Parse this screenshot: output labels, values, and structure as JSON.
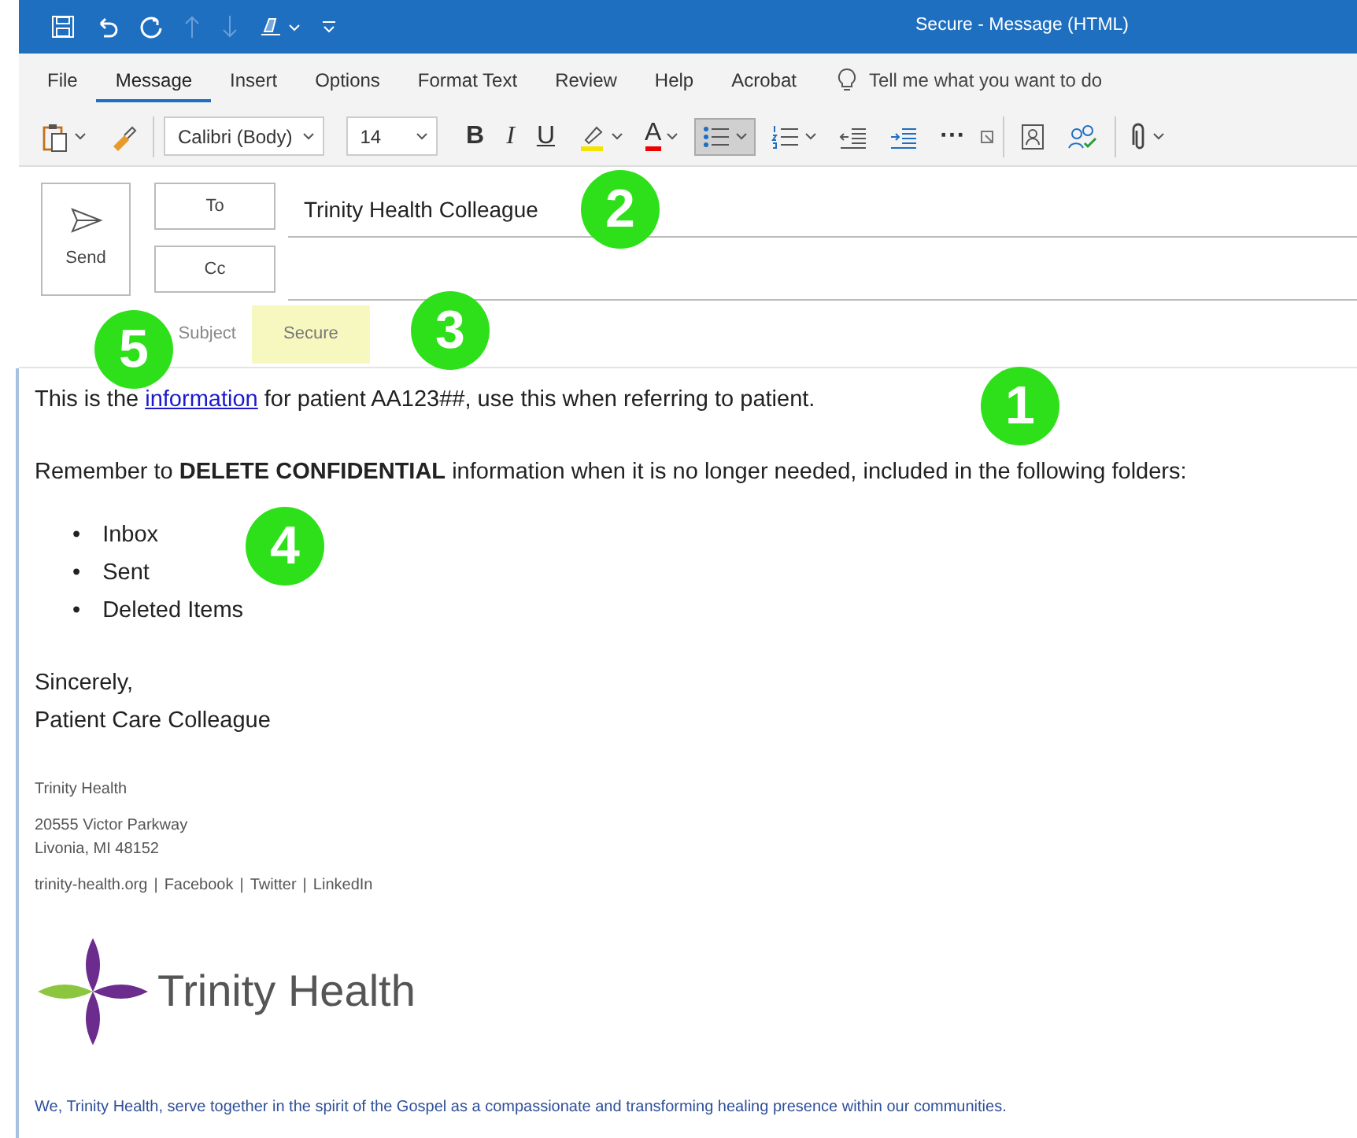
{
  "window": {
    "title": "Secure  -  Message (HTML)"
  },
  "ribbon_tabs": [
    {
      "label": "File",
      "selected": false
    },
    {
      "label": "Message",
      "selected": true
    },
    {
      "label": "Insert",
      "selected": false
    },
    {
      "label": "Options",
      "selected": false
    },
    {
      "label": "Format Text",
      "selected": false
    },
    {
      "label": "Review",
      "selected": false
    },
    {
      "label": "Help",
      "selected": false
    },
    {
      "label": "Acrobat",
      "selected": false
    }
  ],
  "tell_me": "Tell me what you want to do",
  "toolbar": {
    "font": "Calibri (Body)",
    "size": "14",
    "bold": "B",
    "italic": "I",
    "underline": "U",
    "font_color": "A",
    "more": "···",
    "bullets_selected": true
  },
  "send": "Send",
  "to": {
    "label": "To",
    "value": "Trinity Health Colleague"
  },
  "cc": {
    "label": "Cc"
  },
  "subject": {
    "label": "Subject",
    "value": "Secure"
  },
  "body": {
    "intro": {
      "before": "This is the",
      "link": "information",
      "after": "for patient AA123##, use this when referring to patient."
    },
    "reminder": "Remember to **DELETE CONFIDENTIAL** information when it is no longer needed, included in the following folders:",
    "folders": [
      {
        "bullet": "•",
        "text": "Inbox"
      },
      {
        "bullet": "•",
        "text": "Sent"
      },
      {
        "bullet": "•",
        "text": "Deleted Items"
      }
    ],
    "closing": [
      "Sincerely,",
      "Patient Care Colleague"
    ]
  },
  "signature": {
    "org": "Trinity Health",
    "address": [
      "20555 Victor Parkway",
      "Livonia, MI 48152"
    ],
    "links": [
      "trinity-health.org",
      "|",
      "Facebook",
      "|",
      "Twitter",
      "|",
      "LinkedIn"
    ],
    "logo_text": "Trinity Health",
    "motto": "We, Trinity Health, serve together in the spirit of the Gospel as a compassionate and transforming healing presence within our communities."
  },
  "callouts": [
    "1",
    "2",
    "3",
    "4",
    "5"
  ]
}
